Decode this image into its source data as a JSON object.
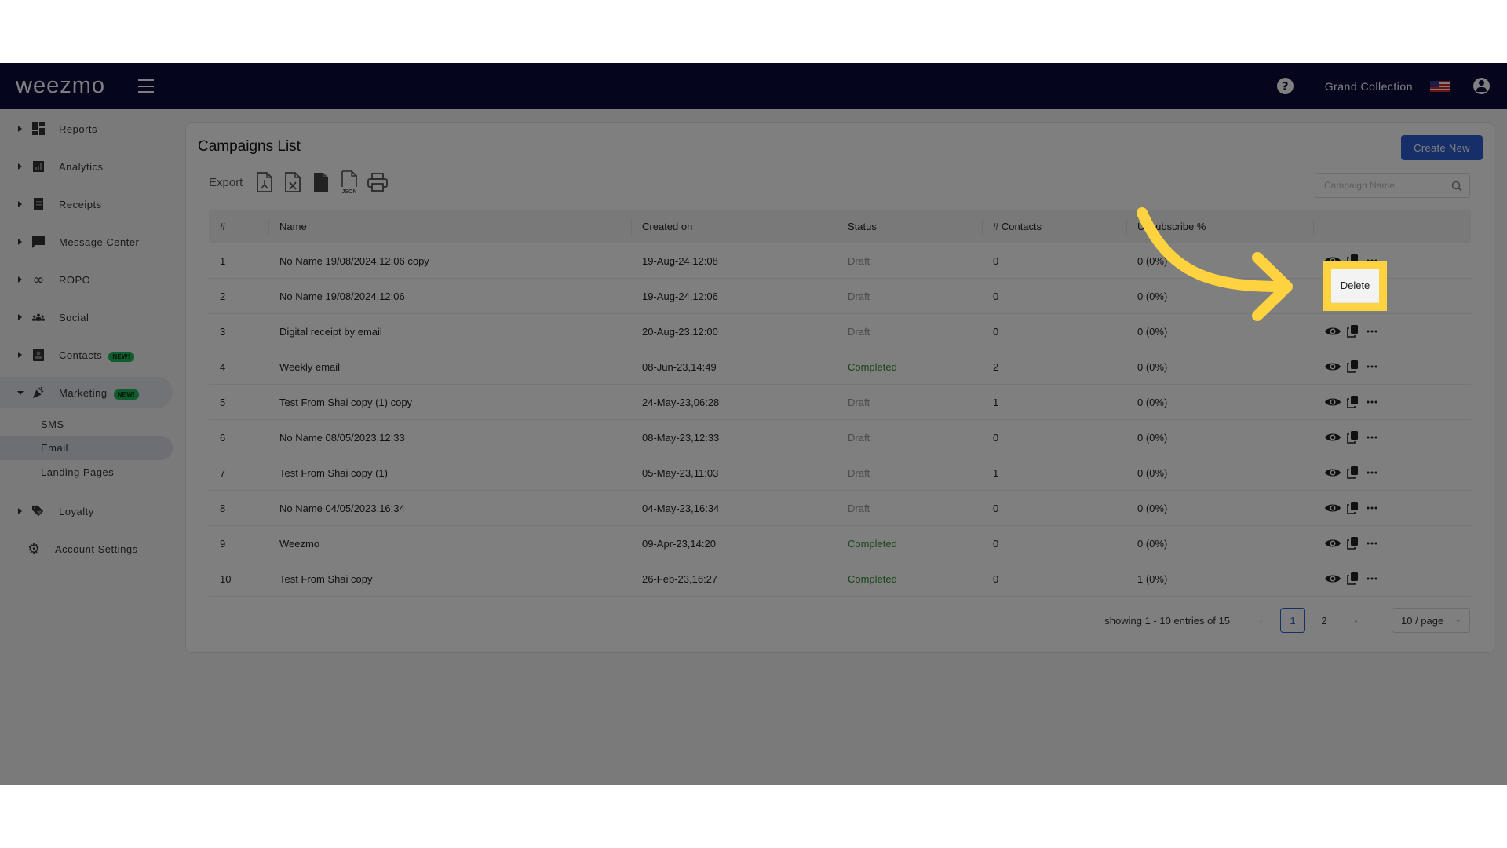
{
  "navbar": {
    "logo": "weezmo",
    "store_name": "Grand Collection",
    "icons": {
      "menu": "hamburger-icon",
      "help": "question-circle-icon",
      "language": "us-flag-icon",
      "account": "user-circle-icon"
    },
    "help_glyph": "?"
  },
  "sidebar": {
    "items": [
      {
        "label": "Reports",
        "icon": "dashboard-icon",
        "glyph": "▦"
      },
      {
        "label": "Analytics",
        "icon": "bar-chart-icon",
        "glyph": "▤"
      },
      {
        "label": "Receipts",
        "icon": "receipt-icon",
        "glyph": "☰"
      },
      {
        "label": "Message Center",
        "icon": "chat-icon",
        "glyph": "▰"
      },
      {
        "label": "ROPO",
        "icon": "infinity-icon",
        "glyph": "∞"
      },
      {
        "label": "Social",
        "icon": "group-icon",
        "glyph": "👥"
      },
      {
        "label": "Contacts",
        "icon": "contacts-icon",
        "glyph": "▣",
        "badge": "NEW!"
      },
      {
        "label": "Marketing",
        "icon": "party-popper-icon",
        "glyph": "✦",
        "badge": "NEW!",
        "expanded": true
      },
      {
        "label": "Loyalty",
        "icon": "tag-heart-icon",
        "glyph": "◈"
      },
      {
        "label": "Account Settings",
        "icon": "gear-icon",
        "glyph": "⚙"
      }
    ],
    "marketing_subitems": [
      {
        "label": "SMS"
      },
      {
        "label": "Email",
        "active": true
      },
      {
        "label": "Landing Pages"
      }
    ]
  },
  "page": {
    "title": "Campaigns List",
    "create_button": "Create New",
    "export_label": "Export",
    "export_formats": [
      "PDF",
      "Excel",
      "CSV",
      "JSON",
      "Print"
    ],
    "search_placeholder": "Campaign Name",
    "search_value": ""
  },
  "table": {
    "columns": [
      "#",
      "Name",
      "Created on",
      "Status",
      "# Contacts",
      "Unsubscribe %",
      ""
    ],
    "rows": [
      {
        "num": "1",
        "name": "No Name 19/08/2024,12:06 copy",
        "created": "19-Aug-24,12:08",
        "status": "Draft",
        "contacts": "0",
        "unsub": "0 (0%)"
      },
      {
        "num": "2",
        "name": "No Name 19/08/2024,12:06",
        "created": "19-Aug-24,12:06",
        "status": "Draft",
        "contacts": "0",
        "unsub": "0 (0%)"
      },
      {
        "num": "3",
        "name": "Digital receipt by email",
        "created": "20-Aug-23,12:00",
        "status": "Draft",
        "contacts": "0",
        "unsub": "0 (0%)"
      },
      {
        "num": "4",
        "name": "Weekly email",
        "created": "08-Jun-23,14:49",
        "status": "Completed",
        "contacts": "2",
        "unsub": "0 (0%)"
      },
      {
        "num": "5",
        "name": "Test From Shai copy (1) copy",
        "created": "24-May-23,06:28",
        "status": "Draft",
        "contacts": "1",
        "unsub": "0 (0%)"
      },
      {
        "num": "6",
        "name": "No Name 08/05/2023,12:33",
        "created": "08-May-23,12:33",
        "status": "Draft",
        "contacts": "0",
        "unsub": "0 (0%)"
      },
      {
        "num": "7",
        "name": "Test From Shai copy (1)",
        "created": "05-May-23,11:03",
        "status": "Draft",
        "contacts": "1",
        "unsub": "0 (0%)"
      },
      {
        "num": "8",
        "name": "No Name 04/05/2023,16:34",
        "created": "04-May-23,16:34",
        "status": "Draft",
        "contacts": "0",
        "unsub": "0 (0%)"
      },
      {
        "num": "9",
        "name": "Weezmo",
        "created": "09-Apr-23,14:20",
        "status": "Completed",
        "contacts": "0",
        "unsub": "0 (0%)"
      },
      {
        "num": "10",
        "name": "Test From Shai copy",
        "created": "26-Feb-23,16:27",
        "status": "Completed",
        "contacts": "0",
        "unsub": "1 (0%)"
      }
    ],
    "row_actions": [
      "eye-icon",
      "copy-icon",
      "more-dots-icon"
    ]
  },
  "pagination": {
    "summary": "showing 1 - 10 entries of 15",
    "pages": [
      "1",
      "2"
    ],
    "current_page": "1",
    "prev": "‹",
    "next": "›",
    "page_size": "10 / page"
  },
  "popup": {
    "delete_label": "Delete"
  },
  "colors": {
    "navbar": "#0a0a3c",
    "primary": "#2f5fd0",
    "completed": "#2e8b2e",
    "badge": "#1fb85a",
    "annotation": "#ffd23f"
  }
}
